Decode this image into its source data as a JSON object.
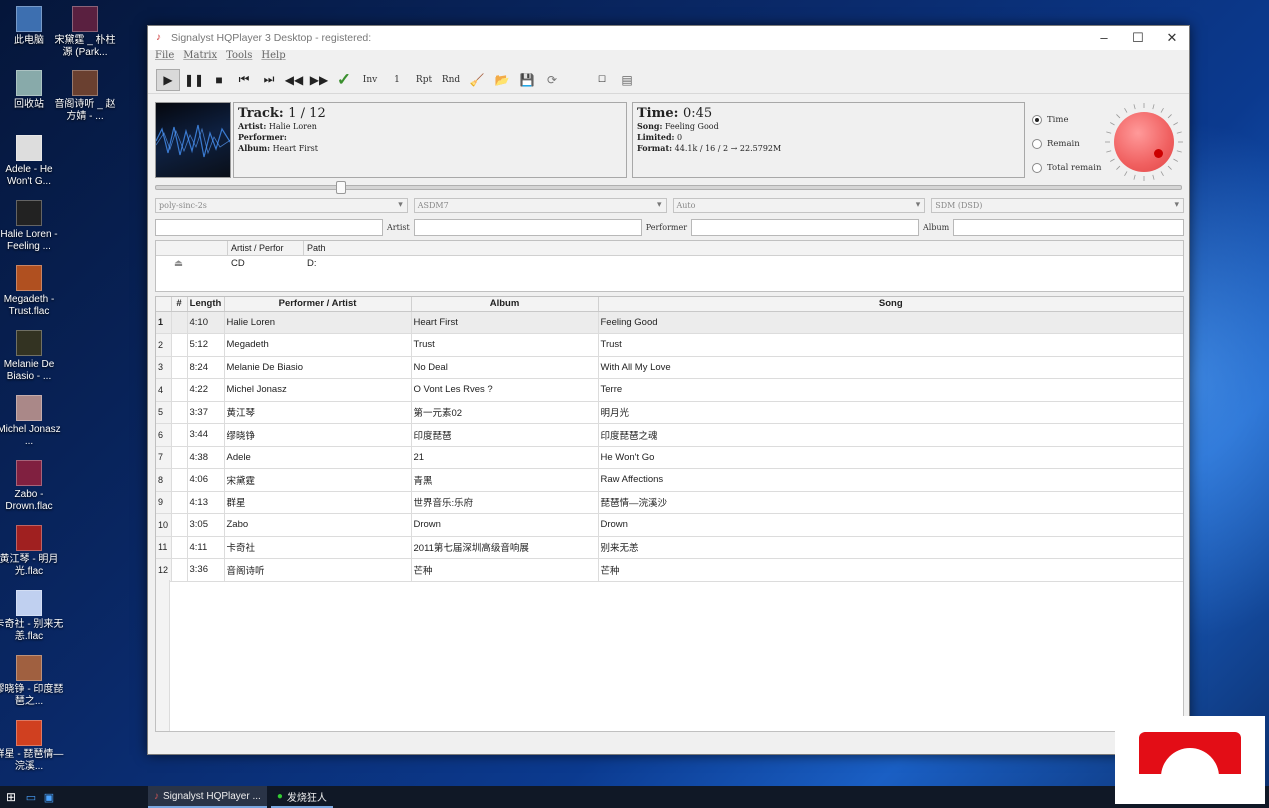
{
  "desktop": {
    "icons": [
      {
        "label": "此电脑"
      },
      {
        "label": "宋黛霆 _ 朴柱源 (Park..."
      },
      {
        "label": "回收站"
      },
      {
        "label": "音阁诗听 _ 赵方婧 - ..."
      },
      {
        "label": "Adele - He Won't G..."
      },
      {
        "label": "Halie Loren - Feeling ..."
      },
      {
        "label": "Megadeth - Trust.flac"
      },
      {
        "label": "Melanie De Biasio - ..."
      },
      {
        "label": "Michel Jonasz ..."
      },
      {
        "label": "Zabo - Drown.flac"
      },
      {
        "label": "黄江琴 - 明月光.flac"
      },
      {
        "label": "卡奇社 - 别来无恙.flac"
      },
      {
        "label": "缪晓铮 - 印度琵琶之..."
      },
      {
        "label": "群星 - 琵琶情—浣溪..."
      }
    ]
  },
  "window": {
    "title": "Signalyst HQPlayer 3 Desktop - registered:",
    "menu": [
      "File",
      "Matrix",
      "Tools",
      "Help"
    ],
    "toolbar": {
      "inv": "Inv",
      "one": "1",
      "rpt": "Rpt",
      "rnd": "Rnd"
    }
  },
  "now_playing": {
    "track_label": "Track:",
    "track_value": "1 / 12",
    "artist_label": "Artist:",
    "artist": "Halie Loren",
    "performer_label": "Performer:",
    "performer": "",
    "album_label": "Album:",
    "album": "Heart First",
    "time_label": "Time:",
    "time_value": "0:45",
    "song_label": "Song:",
    "song": "Feeling Good",
    "limited_label": "Limited:",
    "limited": "0",
    "format_label": "Format:",
    "format": "44.1k / 16 / 2 → 22.5792M",
    "progress_fraction": 0.18
  },
  "display_mode": {
    "options": [
      "Time",
      "Remain",
      "Total remain"
    ],
    "selected": "Time"
  },
  "selects": {
    "filter": "poly-sinc-2s",
    "shaper": "ASDM7",
    "rate": "Auto",
    "mode": "SDM (DSD)"
  },
  "search": {
    "artist_label": "Artist",
    "performer_label": "Performer",
    "album_label": "Album"
  },
  "sources": {
    "headers": [
      "Artist / Perfor",
      "Path"
    ],
    "rows": [
      {
        "artist": "CD",
        "path": "D:"
      }
    ]
  },
  "playlist": {
    "headers": [
      "#",
      "Length",
      "Performer / Artist",
      "Album",
      "Song"
    ],
    "rows": [
      {
        "n": "1",
        "len": "4:10",
        "artist": "Halie Loren",
        "album": "Heart First",
        "song": "Feeling Good"
      },
      {
        "n": "2",
        "len": "5:12",
        "artist": "Megadeth",
        "album": "Trust",
        "song": "Trust"
      },
      {
        "n": "3",
        "len": "8:24",
        "artist": "Melanie De Biasio",
        "album": "No Deal",
        "song": "With All My Love"
      },
      {
        "n": "4",
        "len": "4:22",
        "artist": "Michel Jonasz",
        "album": "O Vont Les Rves ?",
        "song": "Terre"
      },
      {
        "n": "5",
        "len": "3:37",
        "artist": "黄江琴",
        "album": "第一元素02",
        "song": "明月光"
      },
      {
        "n": "6",
        "len": "3:44",
        "artist": "缪晓铮",
        "album": "印度琵琶",
        "song": "印度琵琶之魂"
      },
      {
        "n": "7",
        "len": "4:38",
        "artist": "Adele",
        "album": "21",
        "song": "He Won't Go"
      },
      {
        "n": "8",
        "len": "4:06",
        "artist": "宋黛霆",
        "album": "青黑",
        "song": "Raw Affections"
      },
      {
        "n": "9",
        "len": "4:13",
        "artist": "群星",
        "album": "世界音乐:乐府",
        "song": "琵琶情—浣溪沙"
      },
      {
        "n": "10",
        "len": "3:05",
        "artist": "Zabo",
        "album": "Drown",
        "song": "Drown"
      },
      {
        "n": "11",
        "len": "4:11",
        "artist": "卡奇社",
        "album": "2011第七届深圳高级音响展",
        "song": "别来无恙"
      },
      {
        "n": "12",
        "len": "3:36",
        "artist": "音阁诗听",
        "album": "芒种",
        "song": "芒种"
      }
    ]
  },
  "taskbar": {
    "tasks": [
      "Signalyst HQPlayer ...",
      "发烧狂人"
    ]
  },
  "colors": {
    "knob": "#f06060",
    "accent": "#e30d16"
  }
}
